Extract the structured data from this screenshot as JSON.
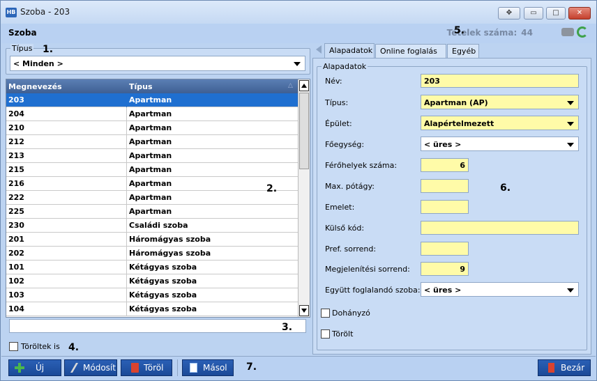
{
  "window": {
    "title": "Szoba - 203",
    "app_icon_text": "HB",
    "controls": [
      "move",
      "minimize",
      "maximize",
      "close"
    ]
  },
  "header": {
    "title": "Szoba",
    "count_label": "Tételek száma:",
    "count_value": "44"
  },
  "markers": {
    "m1": "1.",
    "m2": "2.",
    "m3": "3.",
    "m4": "4.",
    "m5": "5.",
    "m6": "6.",
    "m7": "7."
  },
  "filter": {
    "legend": "Típus",
    "value": "< Minden >"
  },
  "grid": {
    "col_name": "Megnevezés",
    "col_type": "Típus",
    "selected_index": 0,
    "rows": [
      [
        "203",
        "Apartman"
      ],
      [
        "204",
        "Apartman"
      ],
      [
        "210",
        "Apartman"
      ],
      [
        "212",
        "Apartman"
      ],
      [
        "213",
        "Apartman"
      ],
      [
        "215",
        "Apartman"
      ],
      [
        "216",
        "Apartman"
      ],
      [
        "222",
        "Apartman"
      ],
      [
        "225",
        "Apartman"
      ],
      [
        "230",
        "Családi szoba"
      ],
      [
        "201",
        "Háromágyas szoba"
      ],
      [
        "202",
        "Háromágyas szoba"
      ],
      [
        "101",
        "Kétágyas szoba"
      ],
      [
        "102",
        "Kétágyas szoba"
      ],
      [
        "103",
        "Kétágyas szoba"
      ],
      [
        "104",
        "Kétágyas szoba"
      ]
    ]
  },
  "search": {
    "value": ""
  },
  "deleted_checkbox": {
    "label": "Töröltek is",
    "checked": false
  },
  "tabs": [
    {
      "label": "Alapadatok",
      "active": true
    },
    {
      "label": "Online foglalás",
      "active": false
    },
    {
      "label": "Egyéb",
      "active": false
    }
  ],
  "form": {
    "group_legend": "Alapadatok",
    "name_label": "Név:",
    "name_value": "203",
    "type_label": "Típus:",
    "type_value": "Apartman (AP)",
    "building_label": "Épület:",
    "building_value": "Alapértelmezett",
    "unit_label": "Főegység:",
    "unit_value": "< üres >",
    "beds_label": "Férőhelyek száma:",
    "beds_value": "6",
    "extra_label": "Max. pótágy:",
    "extra_value": "",
    "floor_label": "Emelet:",
    "floor_value": "",
    "extcode_label": "Külső kód:",
    "extcode_value": "",
    "pref_label": "Pref. sorrend:",
    "pref_value": "",
    "display_label": "Megjelenítési sorrend:",
    "display_value": "9",
    "together_label": "Együtt foglalandó szoba:",
    "together_value": "< üres >",
    "smoking_label": "Dohányzó",
    "smoking_checked": false,
    "deleted_label": "Törölt",
    "deleted_checked": false
  },
  "toolbar": {
    "new_label": "Új",
    "edit_label": "Módosít",
    "delete_label": "Töröl",
    "copy_label": "Másol",
    "close_label": "Bezár"
  },
  "colors": {
    "selection": "#1f6fd0",
    "field_yellow": "#fffba8",
    "button_blue": "#1b4a98"
  }
}
